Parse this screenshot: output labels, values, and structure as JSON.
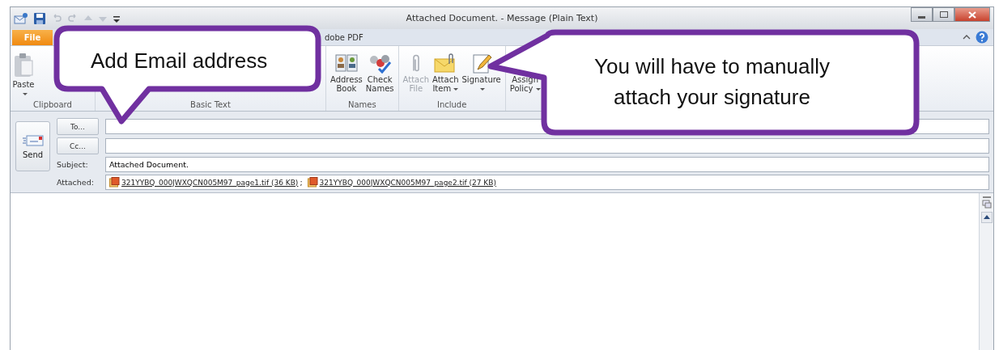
{
  "window": {
    "title": "Attached Document. - Message (Plain Text)"
  },
  "tabs": [
    {
      "label": "File",
      "kind": "file"
    },
    {
      "label": "dobe PDF",
      "kind": "tab"
    }
  ],
  "ribbon": {
    "groups": [
      {
        "label": "Clipboard",
        "kind": "clipboard",
        "buttons": [
          {
            "lines": [
              "Paste"
            ],
            "dropdown": true,
            "disabled": false
          }
        ]
      },
      {
        "label": "Basic Text",
        "kind": "covered"
      },
      {
        "label": "Names",
        "kind": "buttons",
        "buttons": [
          {
            "lines": [
              "Address",
              "Book"
            ],
            "dropdown": false,
            "disabled": false
          },
          {
            "lines": [
              "Check",
              "Names"
            ],
            "dropdown": false,
            "disabled": false
          }
        ]
      },
      {
        "label": "Include",
        "kind": "buttons",
        "buttons": [
          {
            "lines": [
              "Attach",
              "File"
            ],
            "dropdown": false,
            "disabled": true
          },
          {
            "lines": [
              "Attach",
              "Item"
            ],
            "dropdown": true,
            "disabled": false
          },
          {
            "lines": [
              "Signature"
            ],
            "dropdown": true,
            "disabled": false
          }
        ]
      },
      {
        "kind": "buttons",
        "buttons": [
          {
            "lines": [
              "Assign",
              "Policy"
            ],
            "dropdown": true,
            "disabled": false
          }
        ]
      }
    ]
  },
  "compose": {
    "send": "Send",
    "to": "To...",
    "cc": "Cc...",
    "subject_label": "Subject:",
    "subject": "Attached Document.",
    "attached_label": "Attached:",
    "separator": ";",
    "attachments": [
      "321YYBQ_000JWXQCN005M97_page1.tif (36 KB)",
      "321YYBQ_000JWXQCN005M97_page2.tif (27 KB)"
    ]
  },
  "callouts": [
    {
      "kind": "down",
      "lines": [
        "Add Email address"
      ]
    },
    {
      "kind": "left",
      "lines": [
        "You will have to manually",
        "attach your signature"
      ]
    }
  ]
}
